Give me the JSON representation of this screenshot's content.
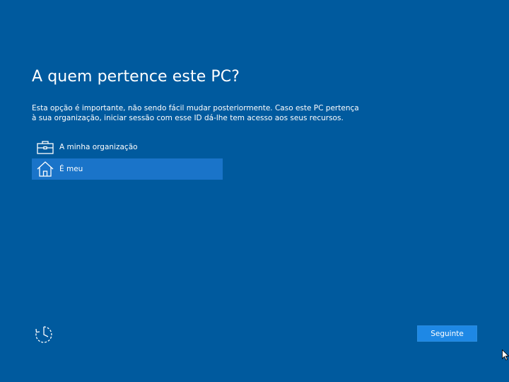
{
  "page": {
    "title": "A quem pertence este PC?",
    "description": "Esta opção é importante, não sendo fácil mudar posteriormente. Caso este PC pertença à sua organização, iniciar sessão com esse ID dá-lhe tem acesso aos seus recursos."
  },
  "options": [
    {
      "label": "A minha organização",
      "icon": "briefcase-icon",
      "selected": false
    },
    {
      "label": "É meu",
      "icon": "home-icon",
      "selected": true
    }
  ],
  "footer": {
    "accessibility_icon": "ease-of-access-icon",
    "next_label": "Seguinte"
  },
  "colors": {
    "background": "#005a9e",
    "selected": "#1a74c9",
    "button": "#1e88e5"
  }
}
